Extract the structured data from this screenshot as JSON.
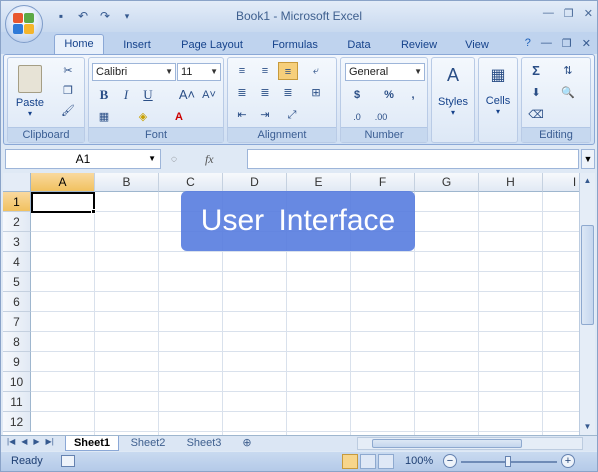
{
  "window": {
    "title": "Book1 - Microsoft Excel"
  },
  "tabs": [
    "Home",
    "Insert",
    "Page Layout",
    "Formulas",
    "Data",
    "Review",
    "View"
  ],
  "ribbon": {
    "clipboard": {
      "label": "Clipboard",
      "paste": "Paste"
    },
    "font": {
      "label": "Font",
      "font_name": "Calibri",
      "font_size": "11"
    },
    "alignment": {
      "label": "Alignment"
    },
    "number": {
      "label": "Number",
      "format": "General"
    },
    "styles": {
      "label": "Styles"
    },
    "cells": {
      "label": "Cells"
    },
    "editing": {
      "label": "Editing"
    }
  },
  "formula_bar": {
    "name_box": "A1",
    "fx": "fx",
    "content": ""
  },
  "grid": {
    "columns": [
      "A",
      "B",
      "C",
      "D",
      "E",
      "F",
      "G",
      "H",
      "I"
    ],
    "rows": [
      "1",
      "2",
      "3",
      "4",
      "5",
      "6",
      "7",
      "8",
      "9",
      "10",
      "11",
      "12"
    ],
    "active_cell": "A1"
  },
  "overlay": {
    "text": "User  Interface",
    "color": "#5b7fe0"
  },
  "sheets": [
    "Sheet1",
    "Sheet2",
    "Sheet3"
  ],
  "active_sheet": "Sheet1",
  "status": {
    "ready": "Ready",
    "zoom": "100%"
  },
  "colors": {
    "selection_header": "#f1c15f",
    "ribbon_text": "#15428b"
  }
}
